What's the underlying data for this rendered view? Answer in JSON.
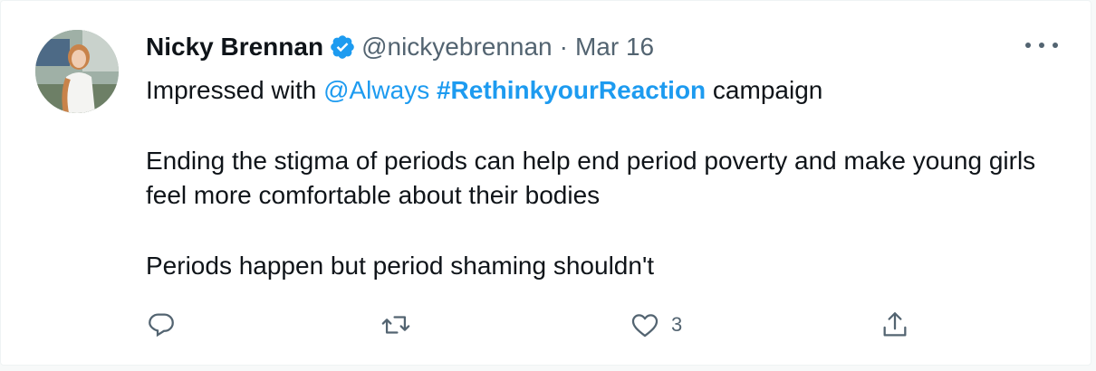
{
  "author": {
    "display_name": "Nicky Brennan",
    "handle": "@nickyebrennan",
    "separator": "·",
    "date": "Mar 16",
    "verified": true
  },
  "tweet": {
    "line1": {
      "prefix": "Impressed with ",
      "mention": "@Always",
      "space": " ",
      "hashtag": "#RethinkyourReaction",
      "suffix": " campaign"
    },
    "paragraph2": "Ending the stigma of periods can help end period poverty and make young girls feel more comfortable about their bodies",
    "paragraph3": "Periods happen but period shaming shouldn't"
  },
  "actions": {
    "reply": {
      "icon": "reply-icon"
    },
    "retweet": {
      "icon": "retweet-icon"
    },
    "like": {
      "icon": "heart-icon",
      "count": "3"
    },
    "share": {
      "icon": "share-icon"
    }
  },
  "colors": {
    "link": "#1d9bf0",
    "secondary_text": "#536471",
    "primary_text": "#0f1419"
  }
}
